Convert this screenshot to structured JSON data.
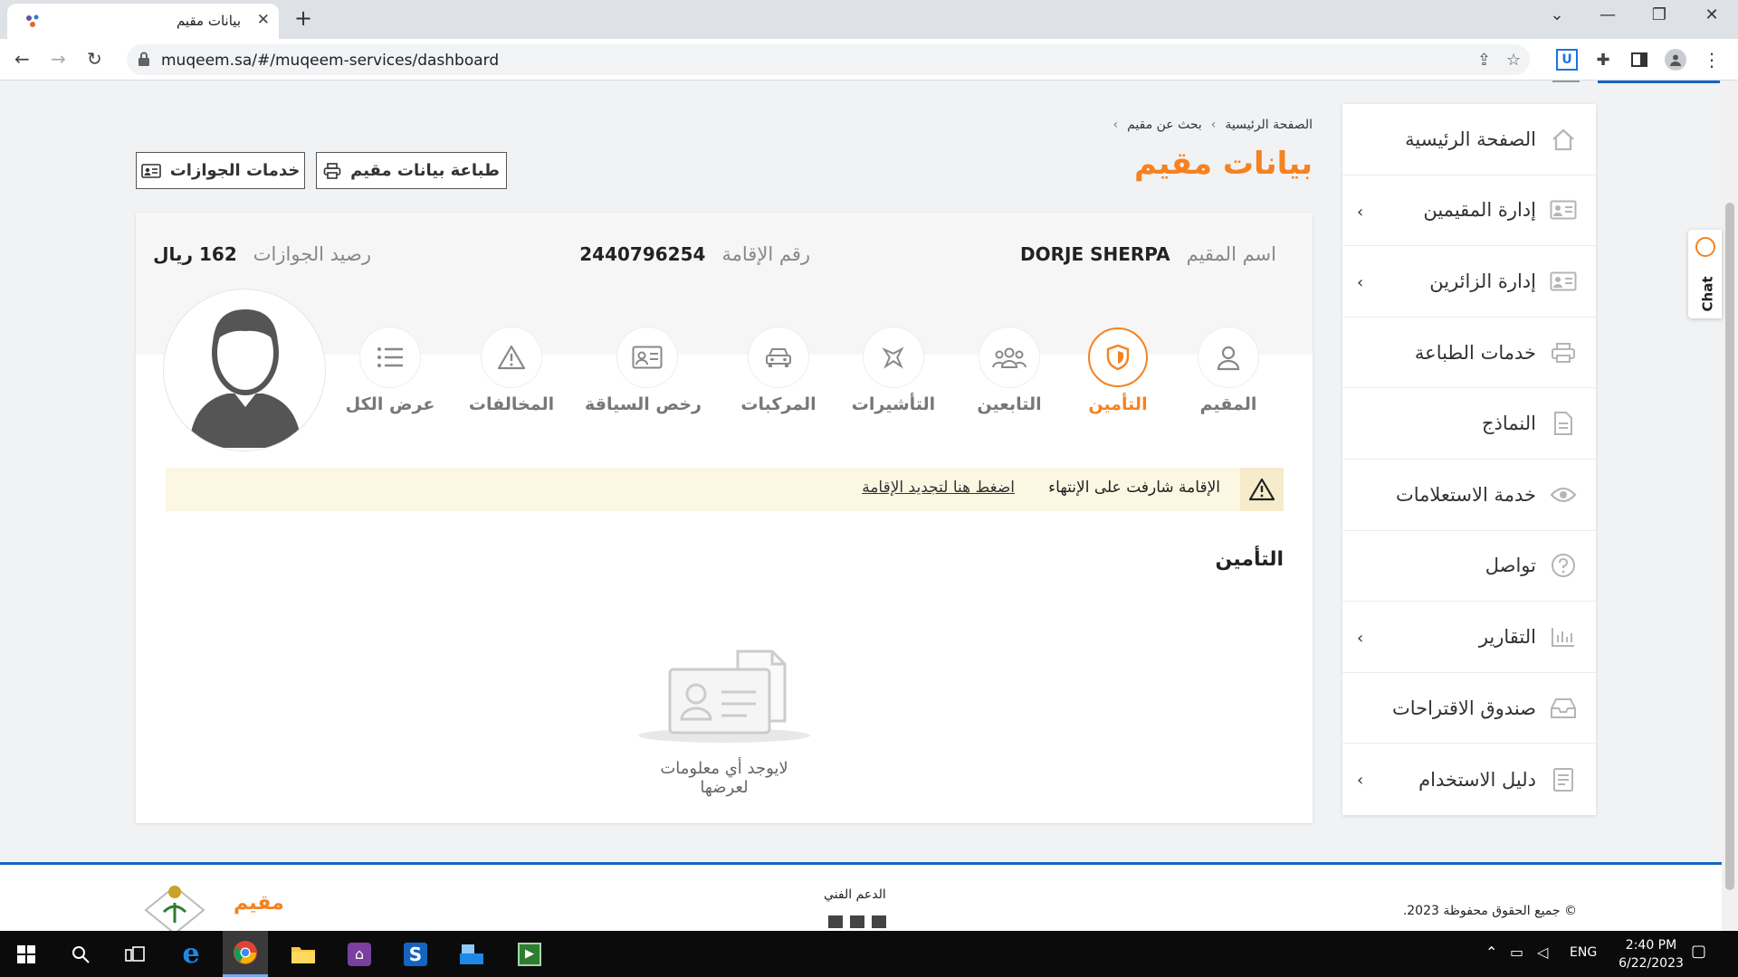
{
  "browser": {
    "tab_title": "بيانات مقيم",
    "tab_close": "✕",
    "new_tab": "+",
    "url": "muqeem.sa/#/muqeem-services/dashboard"
  },
  "breadcrumb": {
    "home": "الصفحة الرئيسية",
    "sep1": "›",
    "search": "بحث عن مقيم",
    "sep2": "›"
  },
  "page_title": "بيانات مقيم",
  "buttons": {
    "print": "طباعة بيانات مقيم",
    "passport_services": "خدمات الجوازات"
  },
  "resident": {
    "name_label": "اسم المقيم",
    "name_value": "DORJE SHERPA",
    "iqama_label": "رقم الإقامة",
    "iqama_value": "2440796254",
    "balance_label": "رصيد الجوازات",
    "balance_value": "162 ريال"
  },
  "tabs": [
    {
      "label": "المقيم",
      "icon": "user-icon"
    },
    {
      "label": "التأمين",
      "icon": "shield-icon",
      "active": true
    },
    {
      "label": "التابعين",
      "icon": "group-icon"
    },
    {
      "label": "التأشيرات",
      "icon": "plane-icon"
    },
    {
      "label": "المركبات",
      "icon": "car-icon"
    },
    {
      "label": "رخص السياقة",
      "icon": "id-card-icon"
    },
    {
      "label": "المخالفات",
      "icon": "warning-icon"
    },
    {
      "label": "عرض الكل",
      "icon": "list-icon"
    }
  ],
  "alert": {
    "message": "الإقامة شارفت على الإنتهاء",
    "link": "اضغط هنا لتجديد الإقامة"
  },
  "section_title": "التأمين",
  "empty_text": "لايوجد أي معلومات لعرضها",
  "sidebar": {
    "items": [
      {
        "label": "الصفحة الرئيسية",
        "icon": "home-icon",
        "chevron": false
      },
      {
        "label": "إدارة المقيمين",
        "icon": "id-card-icon",
        "chevron": true
      },
      {
        "label": "إدارة الزائرين",
        "icon": "id-card-icon",
        "chevron": true
      },
      {
        "label": "خدمات الطباعة",
        "icon": "printer-icon",
        "chevron": false
      },
      {
        "label": "النماذج",
        "icon": "document-icon",
        "chevron": false
      },
      {
        "label": "خدمة الاستعلامات",
        "icon": "eye-icon",
        "chevron": false
      },
      {
        "label": "تواصل",
        "icon": "question-icon",
        "chevron": false
      },
      {
        "label": "التقارير",
        "icon": "chart-icon",
        "chevron": true
      },
      {
        "label": "صندوق الاقتراحات",
        "icon": "inbox-icon",
        "chevron": false
      },
      {
        "label": "دليل الاستخدام",
        "icon": "book-icon",
        "chevron": true
      }
    ],
    "chevron_glyph": "‹"
  },
  "chat_label": "Chat",
  "footer": {
    "copyright": "© جميع الحقوق محفوظة 2023.",
    "support": "الدعم الفني",
    "brand": "مقيم"
  },
  "taskbar": {
    "lang": "ENG",
    "time": "2:40 PM",
    "date": "6/22/2023"
  },
  "colors": {
    "accent": "#f58220",
    "footer_border": "#1565c0",
    "alert_bg": "#fcf7e3"
  }
}
